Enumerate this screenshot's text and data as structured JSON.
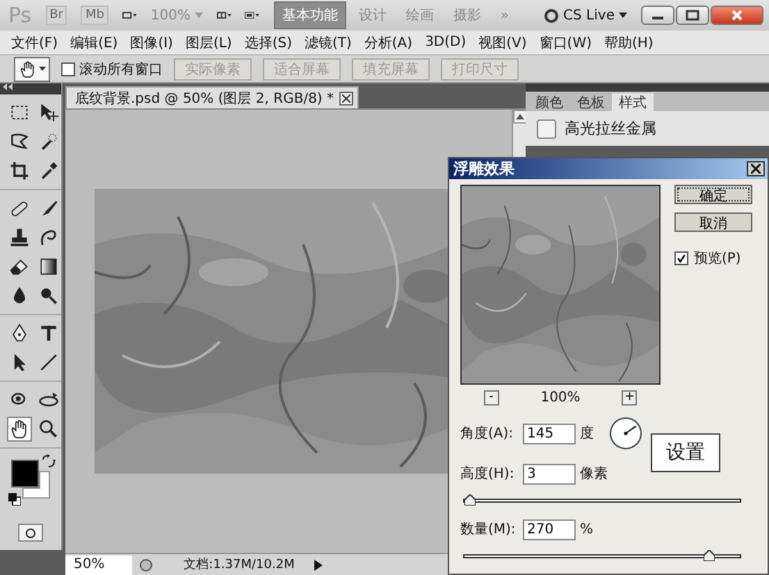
{
  "app_bar": {
    "logo": "Ps",
    "apps": [
      "Br",
      "Mb"
    ],
    "zoom": "100%",
    "workspaces": [
      {
        "label": "基本功能",
        "selected": true
      },
      {
        "label": "设计",
        "selected": false
      },
      {
        "label": "绘画",
        "selected": false
      },
      {
        "label": "摄影",
        "selected": false
      }
    ],
    "more": "»",
    "cs_live": "CS Live"
  },
  "menu": [
    "文件(F)",
    "编辑(E)",
    "图像(I)",
    "图层(L)",
    "选择(S)",
    "滤镜(T)",
    "分析(A)",
    "3D(D)",
    "视图(V)",
    "窗口(W)",
    "帮助(H)"
  ],
  "options_bar": {
    "scroll_all": {
      "label": "滚动所有窗口",
      "checked": false
    },
    "buttons": [
      {
        "label": "实际像素",
        "disabled": true
      },
      {
        "label": "适合屏幕",
        "disabled": true
      },
      {
        "label": "填充屏幕",
        "disabled": true
      },
      {
        "label": "打印尺寸",
        "disabled": true
      }
    ]
  },
  "tools": [
    {
      "selected": false
    },
    {
      "selected": false
    },
    {
      "selected": false
    },
    {
      "selected": false
    },
    {
      "selected": false
    },
    {
      "selected": false
    },
    {
      "selected": false
    },
    {
      "selected": false
    },
    {
      "selected": false
    },
    {
      "selected": false
    },
    {
      "selected": false
    },
    {
      "selected": false
    },
    {
      "selected": false
    },
    {
      "selected": false
    },
    {
      "selected": false
    },
    {
      "selected": false
    },
    {
      "selected": false
    },
    {
      "selected": false
    },
    {
      "selected": false
    },
    {
      "selected": false
    },
    {
      "selected": true
    },
    {
      "selected": false
    }
  ],
  "document": {
    "tab": "底纹背景.psd @ 50% (图层 2, RGB/8) *",
    "zoom": "50%",
    "doc_info": "文档:1.37M/10.2M"
  },
  "panel": {
    "tabs": [
      {
        "label": "颜色",
        "selected": false
      },
      {
        "label": "色板",
        "selected": false
      },
      {
        "label": "样式",
        "selected": true
      }
    ],
    "items": [
      {
        "label": "高光拉丝金属",
        "checked": false
      }
    ]
  },
  "dialog": {
    "title": "浮雕效果",
    "ok": "确定",
    "cancel": "取消",
    "preview": {
      "label": "预览(P)",
      "checked": true
    },
    "zoom": "100%",
    "minus": "-",
    "plus": "+",
    "fields": [
      {
        "kind": "angle",
        "label": "角度(A):",
        "value": "145",
        "unit": "度"
      },
      {
        "kind": "slider",
        "label": "高度(H):",
        "value": "3",
        "unit": "像素",
        "level": 0.02
      },
      {
        "kind": "slider",
        "label": "数量(M):",
        "value": "270",
        "unit": "%",
        "level": 0.89
      }
    ]
  },
  "callout": "设置"
}
